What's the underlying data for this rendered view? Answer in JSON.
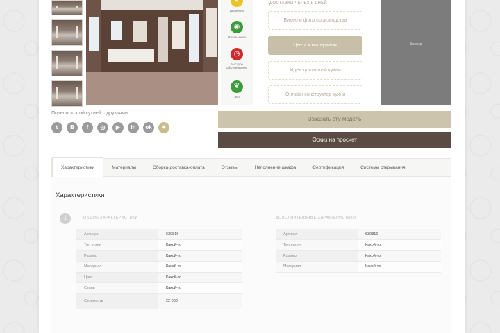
{
  "delivery_text": "ДОСТАВКИ ЧЕРЕЗ 5 ДНЕЙ",
  "features": [
    {
      "label": "Дизайнер",
      "color": "#e9c327",
      "icon": "star-icon"
    },
    {
      "label": "Фотосъемка",
      "color": "#3c9c3c",
      "icon": "camera-icon"
    },
    {
      "label": "Быстрое обслуживание",
      "color": "#cc2b2b",
      "icon": "clock-icon"
    },
    {
      "label": "Эко",
      "color": "#3c9c3c",
      "icon": "leaf-icon"
    }
  ],
  "options": [
    {
      "label": "Видео и фото производства"
    },
    {
      "label": "Цвета и материалы"
    },
    {
      "label": "Идеи для вашей кухни"
    },
    {
      "label": "Онлайн-конструктор кухни"
    }
  ],
  "ad_label": "Баннер",
  "share": {
    "label": "Поделись этой кухней с друзьями :",
    "networks": [
      {
        "icon": "twitter-icon",
        "glyph": "t"
      },
      {
        "icon": "vk-icon",
        "glyph": "B"
      },
      {
        "icon": "facebook-icon",
        "glyph": "f"
      },
      {
        "icon": "instagram-icon",
        "glyph": "◎"
      },
      {
        "icon": "youtube-icon",
        "glyph": "▶"
      },
      {
        "icon": "linkedin-icon",
        "glyph": "in"
      },
      {
        "icon": "odnoklassniki-icon",
        "glyph": "ok"
      },
      {
        "icon": "bird-icon",
        "glyph": "✦"
      }
    ]
  },
  "order_button": "Заказать эту модель",
  "sketch_button": "Эскиз на просчет",
  "tabs": [
    {
      "label": "Характеристики",
      "active": true
    },
    {
      "label": "Материалы"
    },
    {
      "label": "Сборка-доставка-оплата"
    },
    {
      "label": "Отзывы"
    },
    {
      "label": "Наполнение шкафа"
    },
    {
      "label": "Сертификация"
    },
    {
      "label": "Системы открывания"
    }
  ],
  "section_title": "Характеристики",
  "general": {
    "title": "ОБЩИЕ ХАРАКТЕРИСТИКИ",
    "rows": [
      {
        "k": "Артикул",
        "v": "639816"
      },
      {
        "k": "Тип кухни",
        "v": "Какой-то"
      },
      {
        "k": "Размер",
        "v": "Какой-то"
      },
      {
        "k": "Материал",
        "v": "Какой-то"
      },
      {
        "k": "Цвет",
        "v": "Какой-то"
      },
      {
        "k": "Стиль",
        "v": "Какой-то"
      },
      {
        "k": "Стоимость",
        "v": "22 000"
      }
    ]
  },
  "additional": {
    "title": "ДОПОЛНИТЕЛЬНЫЕ ХАРАКТЕРИСТИКИ",
    "rows": [
      {
        "k": "Артикул",
        "v": "639816"
      },
      {
        "k": "Тип кухни",
        "v": "Какой-то"
      },
      {
        "k": "Размер",
        "v": "Какой-то"
      },
      {
        "k": "Материал",
        "v": "Какой-то"
      }
    ]
  }
}
